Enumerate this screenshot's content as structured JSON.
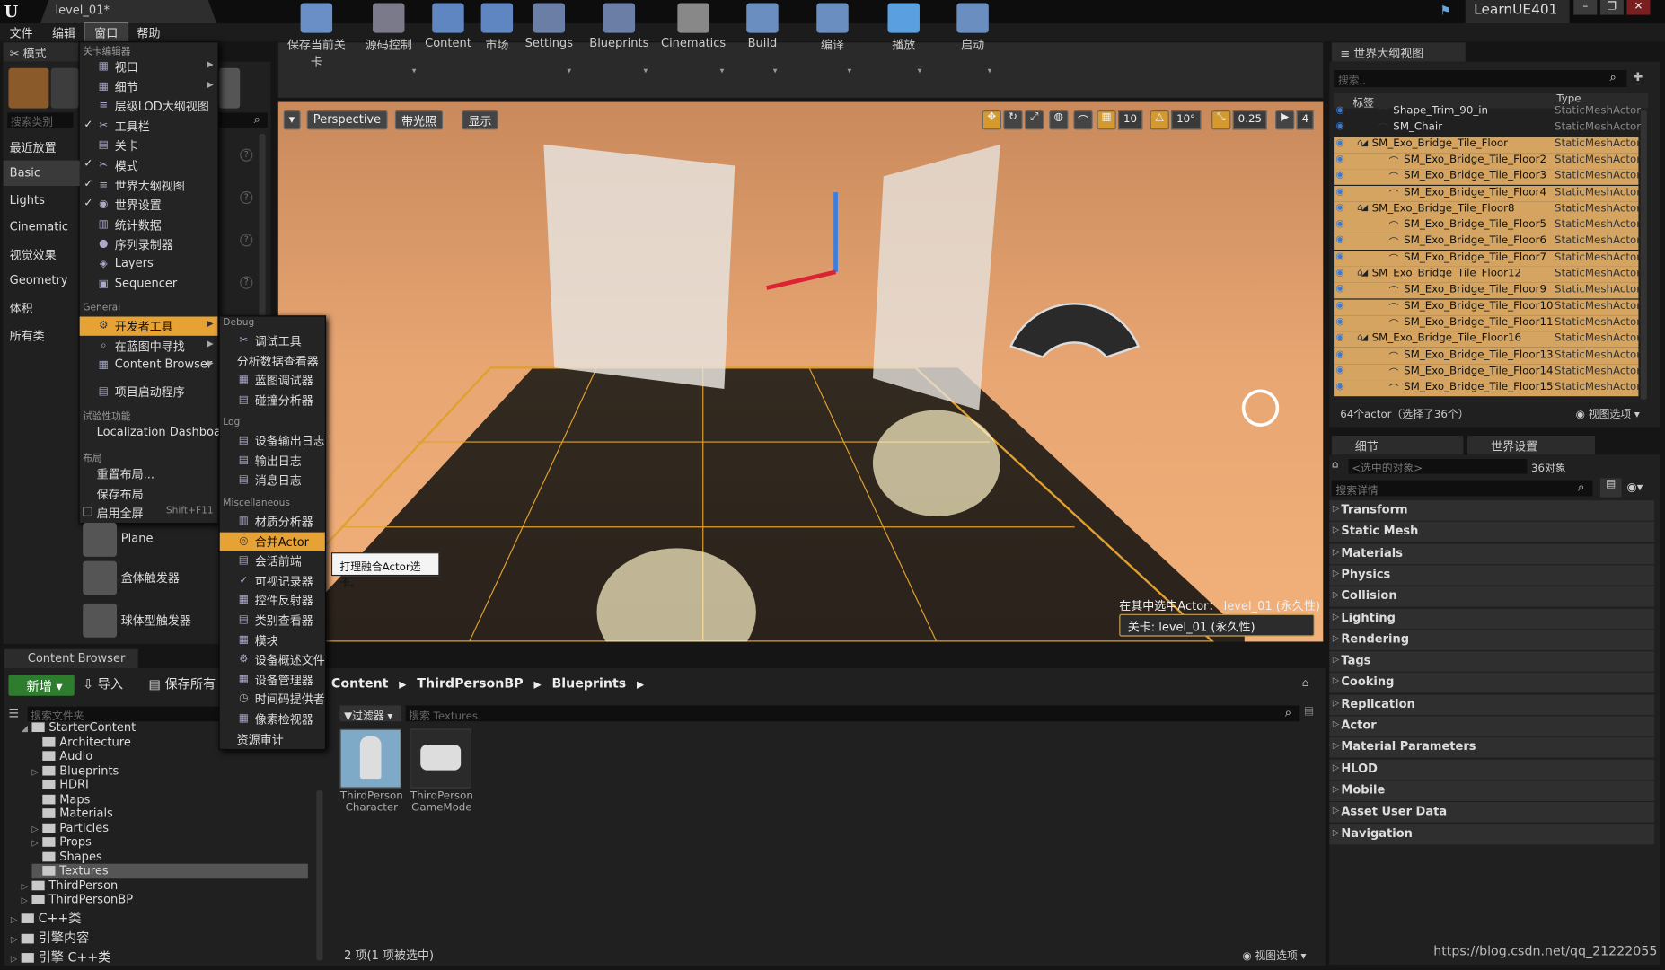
{
  "app": {
    "doc_tab": "level_01*",
    "project": "LearnUE401"
  },
  "menubar": [
    "文件",
    "编辑",
    "窗口",
    "帮助"
  ],
  "modes": {
    "tab": "模式",
    "search": "搜索类别",
    "categories": [
      "最近放置",
      "Basic",
      "Lights",
      "Cinematic",
      "视觉效果",
      "Geometry",
      "体积",
      "所有类"
    ],
    "places": [
      "Plane",
      "盒体触发器",
      "球体型触发器"
    ]
  },
  "toolbar": [
    "保存当前关卡",
    "源码控制",
    "Content",
    "市场",
    "Settings",
    "Blueprints",
    "Cinematics",
    "Build",
    "编译",
    "播放",
    "启动"
  ],
  "viewport": {
    "perspective": "Perspective",
    "lit": "带光照",
    "show": "显示",
    "grid": "10",
    "rot": "10°",
    "scale": "0.25",
    "speed": "4",
    "selected_in": "在其中选中Actor：  level_01 (永久性)",
    "level": "关卡: level_01 (永久性)"
  },
  "outliner": {
    "tab": "世界大纲视图",
    "search": "搜索..",
    "col_label": "标签",
    "col_type": "Type",
    "rows": [
      {
        "name": "Shape_Trim_90_in",
        "type": "StaticMeshActor",
        "indent": 1
      },
      {
        "name": "SM_Chair",
        "type": "StaticMeshActor",
        "indent": 1
      },
      {
        "name": "SM_Exo_Bridge_Tile_Floor",
        "type": "StaticMeshActor",
        "indent": 0,
        "group": true
      },
      {
        "name": "SM_Exo_Bridge_Tile_Floor2",
        "type": "StaticMeshActor",
        "indent": 2
      },
      {
        "name": "SM_Exo_Bridge_Tile_Floor3",
        "type": "StaticMeshActor",
        "indent": 2
      },
      {
        "name": "SM_Exo_Bridge_Tile_Floor4",
        "type": "StaticMeshActor",
        "indent": 2
      },
      {
        "name": "SM_Exo_Bridge_Tile_Floor8",
        "type": "StaticMeshActor",
        "indent": 0,
        "group": true
      },
      {
        "name": "SM_Exo_Bridge_Tile_Floor5",
        "type": "StaticMeshActor",
        "indent": 2
      },
      {
        "name": "SM_Exo_Bridge_Tile_Floor6",
        "type": "StaticMeshActor",
        "indent": 2
      },
      {
        "name": "SM_Exo_Bridge_Tile_Floor7",
        "type": "StaticMeshActor",
        "indent": 2
      },
      {
        "name": "SM_Exo_Bridge_Tile_Floor12",
        "type": "StaticMeshActor",
        "indent": 0,
        "group": true
      },
      {
        "name": "SM_Exo_Bridge_Tile_Floor9",
        "type": "StaticMeshActor",
        "indent": 2
      },
      {
        "name": "SM_Exo_Bridge_Tile_Floor10",
        "type": "StaticMeshActor",
        "indent": 2
      },
      {
        "name": "SM_Exo_Bridge_Tile_Floor11",
        "type": "StaticMeshActor",
        "indent": 2
      },
      {
        "name": "SM_Exo_Bridge_Tile_Floor16",
        "type": "StaticMeshActor",
        "indent": 0,
        "group": true
      },
      {
        "name": "SM_Exo_Bridge_Tile_Floor13",
        "type": "StaticMeshActor",
        "indent": 2
      },
      {
        "name": "SM_Exo_Bridge_Tile_Floor14",
        "type": "StaticMeshActor",
        "indent": 2
      },
      {
        "name": "SM_Exo_Bridge_Tile_Floor15",
        "type": "StaticMeshActor",
        "indent": 2
      }
    ],
    "footer": "64个actor（选择了36个）",
    "view_options": "视图选项"
  },
  "details": {
    "tabs": [
      "细节",
      "世界设置"
    ],
    "selected_placeholder": "<选中的对象>",
    "count": "36对象",
    "search": "搜索详情",
    "sections": [
      "Transform",
      "Static Mesh",
      "Materials",
      "Physics",
      "Collision",
      "Lighting",
      "Rendering",
      "Tags",
      "Cooking",
      "Replication",
      "Actor",
      "Material Parameters",
      "HLOD",
      "Mobile",
      "Asset User Data",
      "Navigation"
    ]
  },
  "content_browser": {
    "tab": "Content Browser",
    "new": "新增",
    "import": "导入",
    "save_all": "保存所有",
    "folder_search": "搜索文件夹",
    "tree": [
      {
        "label": "StarterContent",
        "indent": 1,
        "exp": "◢"
      },
      {
        "label": "Architecture",
        "indent": 2,
        "exp": ""
      },
      {
        "label": "Audio",
        "indent": 2,
        "exp": ""
      },
      {
        "label": "Blueprints",
        "indent": 2,
        "exp": "▷"
      },
      {
        "label": "HDRI",
        "indent": 2,
        "exp": ""
      },
      {
        "label": "Maps",
        "indent": 2,
        "exp": ""
      },
      {
        "label": "Materials",
        "indent": 2,
        "exp": ""
      },
      {
        "label": "Particles",
        "indent": 2,
        "exp": "▷"
      },
      {
        "label": "Props",
        "indent": 2,
        "exp": "▷"
      },
      {
        "label": "Shapes",
        "indent": 2,
        "exp": ""
      },
      {
        "label": "Textures",
        "indent": 2,
        "exp": "",
        "sel": true
      },
      {
        "label": "ThirdPerson",
        "indent": 1,
        "exp": "▷"
      },
      {
        "label": "ThirdPersonBP",
        "indent": 1,
        "exp": "▷"
      },
      {
        "label": "C++类",
        "indent": 0,
        "exp": "▷",
        "big": true
      },
      {
        "label": "引擎内容",
        "indent": 0,
        "exp": "▷",
        "big": true
      },
      {
        "label": "引擎 C++类",
        "indent": 0,
        "exp": "▷",
        "big": true
      }
    ],
    "crumbs": [
      "Content",
      "ThirdPersonBP",
      "Blueprints"
    ],
    "filter": "过滤器",
    "asset_search": "搜索 Textures",
    "assets": [
      "ThirdPerson Character",
      "ThirdPerson GameMode"
    ],
    "status": "2 项(1 项被选中)",
    "view_options": "视图选项"
  },
  "window_menu": {
    "sections": {
      "level_editor": "关卡编辑器",
      "general": "General",
      "experimental": "试验性功能",
      "layout": "布局"
    },
    "items": [
      {
        "label": "视口",
        "check": "",
        "icon": "▦",
        "arrow": true
      },
      {
        "label": "细节",
        "check": "",
        "icon": "▦",
        "arrow": true
      },
      {
        "label": "层级LOD大纲视图",
        "check": "",
        "icon": "≡",
        "arrow": false
      },
      {
        "label": "工具栏",
        "check": "✓",
        "icon": "✂",
        "arrow": false
      },
      {
        "label": "关卡",
        "check": "",
        "icon": "▤",
        "arrow": false
      },
      {
        "label": "模式",
        "check": "✓",
        "icon": "✂",
        "arrow": false
      },
      {
        "label": "世界大纲视图",
        "check": "✓",
        "icon": "≡",
        "arrow": false
      },
      {
        "label": "世界设置",
        "check": "✓",
        "icon": "◉",
        "arrow": false
      },
      {
        "label": "统计数据",
        "check": "",
        "icon": "▥",
        "arrow": false
      },
      {
        "label": "序列录制器",
        "check": "",
        "icon": "●",
        "arrow": false
      },
      {
        "label": "Layers",
        "check": "",
        "icon": "◈",
        "arrow": false
      },
      {
        "label": "Sequencer",
        "check": "",
        "icon": "▣",
        "arrow": false
      }
    ],
    "general": [
      {
        "label": "开发者工具",
        "icon": "⚙",
        "arrow": true,
        "hl": true
      },
      {
        "label": "在蓝图中寻找",
        "icon": "⌕",
        "arrow": true
      },
      {
        "label": "Content Browser",
        "icon": "▦",
        "arrow": true
      },
      {
        "label": "项目启动程序",
        "icon": "▤",
        "arrow": false
      }
    ],
    "experimental": [
      {
        "label": "Localization Dashboard"
      }
    ],
    "layout": [
      {
        "label": "重置布局..."
      },
      {
        "label": "保存布局"
      },
      {
        "label": "启用全屏",
        "shortcut": "Shift+F11",
        "box": true
      }
    ]
  },
  "dev_menu": {
    "sections": {
      "debug": "Debug",
      "log": "Log",
      "misc": "Miscellaneous"
    },
    "debug": [
      "调试工具",
      "分析数据查看器",
      "蓝图调试器",
      "碰撞分析器"
    ],
    "log": [
      "设备输出日志",
      "输出日志",
      "消息日志"
    ],
    "misc": [
      "材质分析器",
      "合并Actor",
      "会话前端",
      "可视记录器",
      "控件反射器",
      "类别查看器",
      "模块",
      "设备概述文件",
      "设备管理器",
      "时间码提供者",
      "像素检视器",
      "资源审计"
    ]
  },
  "tooltip": "打理融合Actor选卡。",
  "watermark": "https://blog.csdn.net/qq_21222055"
}
